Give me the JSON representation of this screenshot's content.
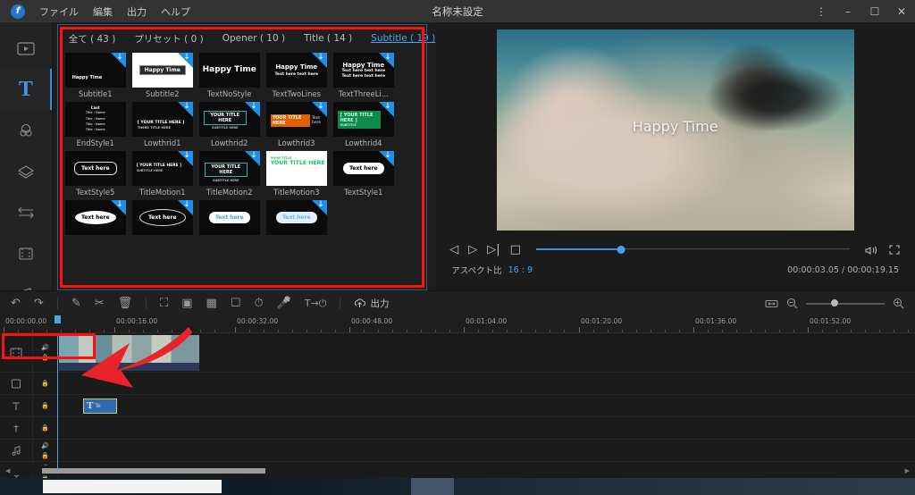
{
  "app": {
    "logo_icon": "filmora-logo-icon",
    "title": "名称未設定",
    "menus": [
      "ファイル",
      "編集",
      "出力",
      "ヘルプ"
    ],
    "window_controls": {
      "more_icon": "kebab-menu-icon",
      "minimize": "–",
      "maximize": "❐",
      "close": "✕"
    }
  },
  "rail": {
    "items": [
      {
        "name": "media-icon",
        "glyph": "▷",
        "active": false
      },
      {
        "name": "text-icon",
        "glyph": "T",
        "active": true
      },
      {
        "name": "audio-icon",
        "glyph": "◎",
        "active": false
      },
      {
        "name": "transition-icon",
        "glyph": "◇",
        "active": false
      },
      {
        "name": "effects-icon",
        "glyph": "⇆",
        "active": false
      },
      {
        "name": "elements-icon",
        "glyph": "▤",
        "active": false
      },
      {
        "name": "music-icon",
        "glyph": "♫",
        "active": false
      }
    ]
  },
  "library": {
    "tabs": [
      {
        "label": "全て ( 43 )",
        "active": false
      },
      {
        "label": "プリセット ( 0 )",
        "active": false
      },
      {
        "label": "Opener ( 10 )",
        "active": false
      },
      {
        "label": "Title ( 14 )",
        "active": false
      },
      {
        "label": "Subtitle ( 19 )",
        "active": true
      }
    ],
    "items": [
      {
        "caption": "Subtitle1",
        "art": "small-white-text",
        "text": "Happy Time",
        "download": true,
        "bg": "dark"
      },
      {
        "caption": "Subtitle2",
        "art": "chip",
        "text": "Happy Time",
        "download": true,
        "bg": "white"
      },
      {
        "caption": "TextNoStyle",
        "art": "big-text",
        "text": "Happy Time",
        "download": false,
        "bg": "dark"
      },
      {
        "caption": "TextTwoLines",
        "art": "two-lines",
        "text": "Happy Time",
        "sub": "Text here text here",
        "download": true,
        "bg": "dark"
      },
      {
        "caption": "TextThreeLi...",
        "art": "three-lines",
        "text": "Happy Time",
        "sub": "Text here text here",
        "download": true,
        "bg": "dark"
      },
      {
        "caption": "EndStyle1",
        "art": "credit-list",
        "text": "Cast",
        "sub": "Title : Name",
        "download": false,
        "bg": "dark"
      },
      {
        "caption": "Lowthrid1",
        "art": "lower-third-plain",
        "text": "[ YOUR TITLE HERE ]",
        "sub": "THERE  TITLE  HERE",
        "download": true,
        "bg": "dark"
      },
      {
        "caption": "Lowthrid2",
        "art": "lower-third-box",
        "text": "YOUR TITLE HERE",
        "sub": "SUBTITLE HERE",
        "download": true,
        "bg": "dark"
      },
      {
        "caption": "Lowthrid3",
        "art": "lower-third-orange",
        "text": "YOUR TITLE HERE",
        "sub": "Text here",
        "download": true,
        "bg": "dark"
      },
      {
        "caption": "Lowthrid4",
        "art": "lower-third-green",
        "text": "[ YOUR TITLE HERE ]",
        "sub": "SUBTITLE",
        "download": true,
        "bg": "dark"
      },
      {
        "caption": "TextStyle5",
        "art": "speech-outline",
        "text": "Text here",
        "download": false,
        "bg": "dark"
      },
      {
        "caption": "TitleMotion1",
        "art": "motion-plain",
        "text": "[ YOUR TITLE HERE ]",
        "sub": "SUBTITLE HERE",
        "download": true,
        "bg": "dark"
      },
      {
        "caption": "TitleMotion2",
        "art": "motion-box",
        "text": "YOUR TITLE HERE",
        "sub": "SUBTITLE HERE",
        "download": true,
        "bg": "dark"
      },
      {
        "caption": "TitleMotion3",
        "art": "motion-green-white",
        "text": "YOUR TITLE HERE",
        "sub": "YOUR TITLE",
        "download": false,
        "bg": "white"
      },
      {
        "caption": "TextStyle1",
        "art": "speech-white",
        "text": "Text here",
        "download": true,
        "bg": "dark"
      },
      {
        "caption": "",
        "art": "cloud-bubble",
        "text": "Text here",
        "download": true,
        "bg": "dark"
      },
      {
        "caption": "",
        "art": "ellipse-bubble",
        "text": "Text here",
        "download": true,
        "bg": "dark"
      },
      {
        "caption": "",
        "art": "blue-bubble",
        "text": "Text here",
        "download": false,
        "bg": "dark"
      },
      {
        "caption": "",
        "art": "pale-bubble",
        "text": "Text here",
        "download": true,
        "bg": "dark"
      }
    ]
  },
  "preview": {
    "overlay_text": "Happy Time",
    "controls": [
      {
        "name": "prev-frame-button",
        "glyph": "◁"
      },
      {
        "name": "play-button",
        "glyph": "▷"
      },
      {
        "name": "next-frame-button",
        "glyph": "▷"
      },
      {
        "name": "stop-button",
        "glyph": "□"
      }
    ],
    "volume_icon": "volume-icon",
    "fullscreen_icon": "fullscreen-icon",
    "aspect_label": "アスペクト比",
    "aspect_value": "16 : 9",
    "current_time": "00:00:03.05",
    "total_time": "00:00:19.15",
    "progress_percent": 27
  },
  "toolbar": {
    "buttons": [
      {
        "name": "undo-button",
        "glyph": "↶"
      },
      {
        "name": "redo-button",
        "glyph": "↷"
      },
      {
        "name": "separator",
        "glyph": ""
      },
      {
        "name": "edit-button",
        "glyph": "✎"
      },
      {
        "name": "split-button",
        "glyph": "✂"
      },
      {
        "name": "delete-button",
        "glyph": "Ὕ1"
      },
      {
        "name": "separator",
        "glyph": ""
      },
      {
        "name": "crop-button",
        "glyph": "⛶"
      },
      {
        "name": "mosaic-button",
        "glyph": "▣"
      },
      {
        "name": "color-button",
        "glyph": "▦"
      },
      {
        "name": "snapshot-button",
        "glyph": "□"
      },
      {
        "name": "speed-button",
        "glyph": "◴"
      },
      {
        "name": "voiceover-button",
        "glyph": "♁"
      },
      {
        "name": "text-to-speech-button",
        "glyph": "T→"
      },
      {
        "name": "separator",
        "glyph": ""
      }
    ],
    "export_icon": "export-icon",
    "export_label": "出力",
    "fit-timeline_icon": "fit-timeline-icon",
    "zoom_out_icon": "zoom-out-icon",
    "zoom_in_icon": "zoom-in-icon",
    "zoom_percent": 32
  },
  "timeline": {
    "ruler_labels": [
      "00:00:00.00",
      "00:00:16.00",
      "00:00:32.00",
      "00:00:48.00",
      "00:01:04.00",
      "00:01:20.00",
      "00:01:36.00",
      "00:01:52.00"
    ],
    "tracks": [
      {
        "name": "video-track",
        "icon": "film-icon",
        "mute_icon": "speaker-icon",
        "lock_icon": "lock-icon"
      },
      {
        "name": "pip-track",
        "icon": "pip-icon",
        "mute_icon": "",
        "lock_icon": "lock-icon"
      },
      {
        "name": "text-track",
        "icon": "text-track-icon",
        "mute_icon": "",
        "lock_icon": "lock-icon"
      },
      {
        "name": "effects-track",
        "icon": "fx-track-icon",
        "mute_icon": "",
        "lock_icon": "lock-icon"
      },
      {
        "name": "music-track",
        "icon": "music-track-icon",
        "mute_icon": "speaker-icon",
        "lock_icon": "lock-icon"
      },
      {
        "name": "voice-track",
        "icon": "mic-track-icon",
        "mute_icon": "speaker-icon",
        "lock_icon": "lock-icon"
      }
    ],
    "text_clip_label": "Te",
    "text_clip_icon": "T"
  },
  "annotations": {
    "highlight_color": "#ff1010",
    "arrow_color": "#e8232a"
  }
}
